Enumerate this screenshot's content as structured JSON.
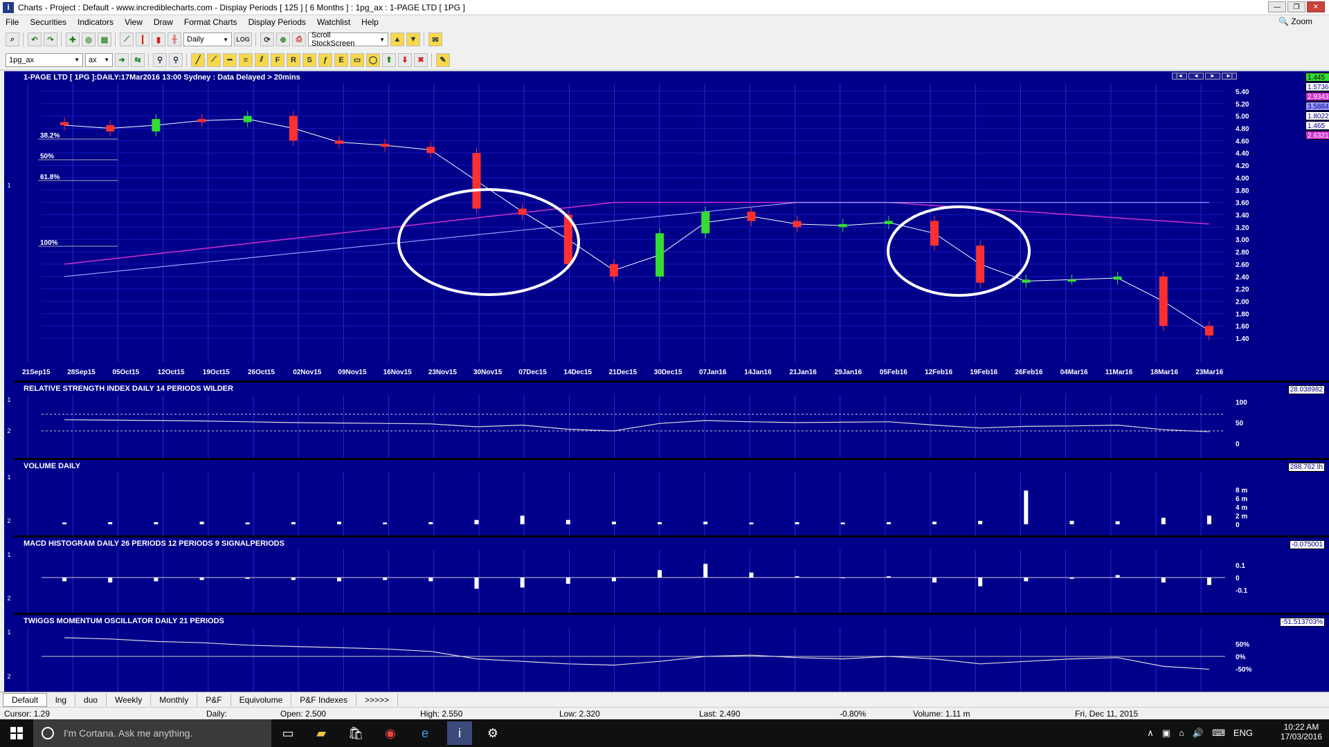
{
  "window": {
    "title": "Charts - Project : Default - www.incrediblecharts.com - Display Periods  [ 125 ]  [ 6 Months ]  :  1pg_ax : 1-PAGE LTD  [ 1PG ]"
  },
  "menu": [
    "File",
    "Securities",
    "Indicators",
    "View",
    "Draw",
    "Format Charts",
    "Display Periods",
    "Watchlist",
    "Help"
  ],
  "zoom_label": "Zoom",
  "toolbar": {
    "period": "Daily",
    "log": "LOG",
    "scroll": "Scroll StockScreen",
    "symbol": "1pg_ax",
    "exchange": "ax"
  },
  "price_panel": {
    "title": "1-PAGE LTD [ 1PG ]:DAILY:17Mar2016 13:00 Sydney : Data Delayed > 20mins",
    "side": "1",
    "yticks": [
      "5.40",
      "5.20",
      "5.00",
      "4.80",
      "4.60",
      "4.40",
      "4.20",
      "4.00",
      "3.80",
      "3.60",
      "3.40",
      "3.20",
      "3.00",
      "2.80",
      "2.60",
      "2.40",
      "2.20",
      "2.00",
      "1.80",
      "1.60",
      "1.40"
    ],
    "fib": [
      "38.2%",
      "50%",
      "61.8%",
      "100%"
    ],
    "dates": [
      "21Sep15",
      "28Sep15",
      "05Oct15",
      "12Oct15",
      "19Oct15",
      "26Oct15",
      "02Nov15",
      "09Nov15",
      "16Nov15",
      "23Nov15",
      "30Nov15",
      "07Dec15",
      "14Dec15",
      "21Dec15",
      "30Dec15",
      "07Jan16",
      "14Jan16",
      "21Jan16",
      "29Jan16",
      "05Feb16",
      "12Feb16",
      "19Feb16",
      "26Feb16",
      "04Mar16",
      "11Mar16",
      "18Mar16",
      "23Mar16"
    ],
    "legend": [
      {
        "v": "1.445",
        "bg": "#33dd33",
        "fg": "#000"
      },
      {
        "v": "1.57365",
        "bg": "#ffffff",
        "fg": "#00008b"
      },
      {
        "v": "2.934368",
        "bg": "#cc33cc",
        "fg": "#fff"
      },
      {
        "v": "3.588467",
        "bg": "#9999ff",
        "fg": "#00008b"
      },
      {
        "v": "1.802222",
        "bg": "#ffffff",
        "fg": "#00008b"
      },
      {
        "v": "1.465",
        "bg": "#ffffff",
        "fg": "#00008b"
      },
      {
        "v": "2.632135",
        "bg": "#cc33cc",
        "fg": "#fff"
      }
    ],
    "nav": [
      "|◄",
      "◄",
      "►",
      "►|"
    ]
  },
  "rsi_panel": {
    "title": "RELATIVE STRENGTH INDEX DAILY 14 PERIODS WILDER",
    "value": "28.038982",
    "ticks": [
      "100",
      "50",
      "0"
    ],
    "side": [
      "1",
      "2"
    ]
  },
  "volume_panel": {
    "title": "VOLUME DAILY",
    "value": "288.762 th",
    "ticks": [
      "8 m",
      "6 m",
      "4 m",
      "2 m",
      "0"
    ],
    "side": [
      "1",
      "2"
    ]
  },
  "macd_panel": {
    "title": "MACD HISTOGRAM DAILY 26 PERIODS 12 PERIODS 9 SIGNALPERIODS",
    "value": "-0.075001",
    "ticks": [
      "0.1",
      "0",
      "-0.1"
    ],
    "side": [
      "1",
      "2"
    ]
  },
  "twiggs_panel": {
    "title": "TWIGGS MOMENTUM OSCILLATOR DAILY 21 PERIODS",
    "value": "-51.513703%",
    "ticks": [
      "50%",
      "0%",
      "-50%"
    ],
    "side": [
      "1",
      "2"
    ]
  },
  "tabs": [
    "Default",
    "lng",
    "duo",
    "Weekly",
    "Monthly",
    "P&F",
    "Equivolume",
    "P&F Indexes",
    ">>>>>"
  ],
  "status": {
    "cursor": "Cursor: 1.29",
    "period": "Daily:",
    "open": "Open: 2.500",
    "high": "High: 2.550",
    "low": "Low: 2.320",
    "last": "Last: 2.490",
    "change": "-0.80%",
    "volume": "Volume: 1.11 m",
    "date": "Fri, Dec 11, 2015"
  },
  "taskbar": {
    "search": "I'm Cortana. Ask me anything.",
    "lang": "ENG",
    "time": "10:22 AM",
    "date": "17/03/2016"
  },
  "chart_data": {
    "type": "candlestick",
    "title": "1-PAGE LTD [ 1PG ]:DAILY:17Mar2016 13:00 Sydney : Data Delayed > 20mins",
    "ylim": [
      1.3,
      5.5
    ],
    "x": [
      "21Sep15",
      "28Sep15",
      "05Oct15",
      "12Oct15",
      "19Oct15",
      "26Oct15",
      "02Nov15",
      "09Nov15",
      "16Nov15",
      "23Nov15",
      "30Nov15",
      "07Dec15",
      "14Dec15",
      "21Dec15",
      "30Dec15",
      "07Jan16",
      "14Jan16",
      "21Jan16",
      "29Jan16",
      "05Feb16",
      "12Feb16",
      "19Feb16",
      "26Feb16",
      "04Mar16",
      "11Mar16",
      "18Mar16"
    ],
    "close": [
      4.85,
      4.75,
      4.95,
      4.9,
      5.0,
      4.6,
      4.55,
      4.5,
      4.4,
      3.5,
      3.4,
      2.6,
      2.4,
      3.1,
      3.45,
      3.3,
      3.2,
      3.25,
      3.3,
      2.9,
      2.3,
      2.35,
      2.35,
      2.4,
      1.6,
      1.445
    ],
    "rsi": [
      57,
      56,
      55,
      54,
      52,
      50,
      49,
      48,
      47,
      40,
      44,
      34,
      30,
      48,
      55,
      52,
      50,
      51,
      52,
      44,
      37,
      41,
      42,
      44,
      33,
      28
    ],
    "volume_m": [
      0.4,
      0.5,
      0.5,
      0.6,
      0.4,
      0.5,
      0.6,
      0.4,
      0.5,
      1.0,
      2.0,
      1.0,
      0.6,
      0.5,
      0.6,
      0.4,
      0.5,
      0.4,
      0.5,
      0.6,
      0.8,
      7.8,
      0.8,
      0.7,
      1.5,
      2.0
    ],
    "macd": [
      -0.03,
      -0.04,
      -0.03,
      -0.02,
      -0.01,
      -0.02,
      -0.03,
      -0.02,
      -0.03,
      -0.09,
      -0.08,
      -0.05,
      -0.03,
      0.06,
      0.11,
      0.04,
      0.01,
      0.0,
      0.01,
      -0.04,
      -0.07,
      -0.03,
      -0.01,
      0.02,
      -0.04,
      -0.06
    ],
    "twiggs": [
      75,
      70,
      60,
      55,
      45,
      40,
      35,
      30,
      20,
      -10,
      -20,
      -30,
      -35,
      -20,
      0,
      5,
      -5,
      -10,
      0,
      -10,
      -30,
      -20,
      -10,
      -5,
      -40,
      -51.5
    ]
  }
}
